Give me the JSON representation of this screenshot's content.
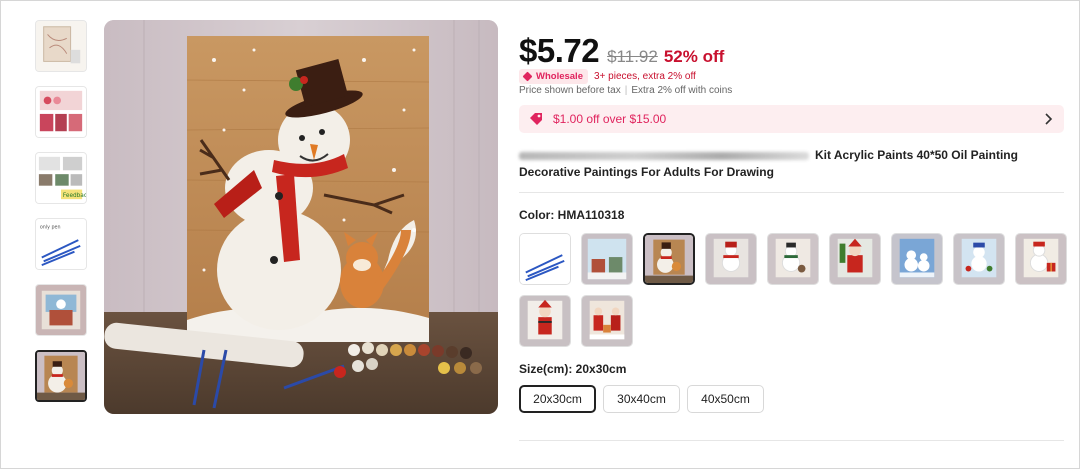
{
  "thumbnails": [
    {
      "name": "thumb-1",
      "kind": "sketch"
    },
    {
      "name": "thumb-2",
      "kind": "paint-kit"
    },
    {
      "name": "thumb-3",
      "kind": "steps"
    },
    {
      "name": "thumb-4",
      "kind": "brushes"
    },
    {
      "name": "thumb-5",
      "kind": "painting"
    },
    {
      "name": "thumb-6",
      "kind": "snowman",
      "selected": true
    }
  ],
  "price": {
    "current": "$5.72",
    "original": "$11.92",
    "discount": "52% off"
  },
  "wholesale": {
    "badge": "Wholesale",
    "text": "3+ pieces, extra 2% off"
  },
  "tax": {
    "note": "Price shown before tax",
    "sep": "|",
    "coins": "Extra 2% off with coins"
  },
  "coupon": {
    "text": "$1.00 off over $15.00",
    "icon": "coupon-tag-icon"
  },
  "product": {
    "title_visible": "Kit Acrylic Paints 40*50 Oil Painting Decorative Paintings For Adults For Drawing"
  },
  "color": {
    "label": "Color: HMA110318",
    "swatches": [
      "brushes",
      "village",
      "snowman-fox",
      "snowman-red",
      "snowman-cat",
      "santa",
      "snowmen-blue",
      "snowman-kids",
      "snowman-gift",
      "santa-red",
      "santa-group"
    ],
    "selected_index": 2
  },
  "size": {
    "label": "Size(cm): 20x30cm",
    "options": [
      "20x30cm",
      "30x40cm",
      "40x50cm"
    ],
    "selected_index": 0
  },
  "colors": {
    "accent": "#e0245e",
    "discount": "#c8102e",
    "coupon_bg": "#fdeef0"
  }
}
